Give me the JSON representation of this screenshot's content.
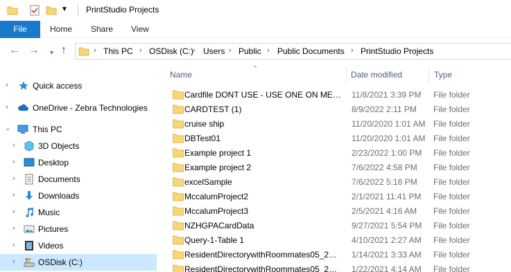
{
  "window": {
    "title": "PrintStudio Projects"
  },
  "quick_access_toolbar": [
    "folder-icon",
    "properties-icon",
    "new-folder-icon",
    "customize-dropdown"
  ],
  "ribbon": {
    "tabs": [
      "File",
      "Home",
      "Share",
      "View"
    ]
  },
  "address": {
    "crumbs": [
      "This PC",
      "OSDisk (C:)",
      "Users",
      "Public",
      "Public Documents",
      "PrintStudio Projects"
    ]
  },
  "nav": {
    "items": [
      {
        "label": "Quick access",
        "icon": "star-icon"
      },
      {
        "label": "OneDrive - Zebra Technologies",
        "icon": "cloud-icon"
      },
      {
        "label": "This PC",
        "icon": "computer-icon",
        "expanded": true
      },
      {
        "label": "3D Objects",
        "icon": "cube-icon"
      },
      {
        "label": "Desktop",
        "icon": "desktop-icon"
      },
      {
        "label": "Documents",
        "icon": "document-icon"
      },
      {
        "label": "Downloads",
        "icon": "download-icon"
      },
      {
        "label": "Music",
        "icon": "music-icon"
      },
      {
        "label": "Pictures",
        "icon": "picture-icon"
      },
      {
        "label": "Videos",
        "icon": "video-icon"
      },
      {
        "label": "OSDisk (C:)",
        "icon": "drive-icon",
        "selected": true
      }
    ]
  },
  "files": {
    "columns": {
      "name": "Name",
      "date": "Date modified",
      "type": "Type"
    },
    "rows": [
      {
        "name": "Cardfile DONT USE - USE ONE ON MEMB...",
        "date": "11/8/2021 3:39 PM",
        "type": "File folder"
      },
      {
        "name": "CARDTEST (1)",
        "date": "8/9/2022 2:11 PM",
        "type": "File folder"
      },
      {
        "name": "cruise ship",
        "date": "11/20/2020 1:01 AM",
        "type": "File folder"
      },
      {
        "name": "DBTest01",
        "date": "11/20/2020 1:01 AM",
        "type": "File folder"
      },
      {
        "name": "Example project 1",
        "date": "2/23/2022 1:00 PM",
        "type": "File folder"
      },
      {
        "name": "Example project 2",
        "date": "7/6/2022 4:58 PM",
        "type": "File folder"
      },
      {
        "name": "excelSample",
        "date": "7/6/2022 5:16 PM",
        "type": "File folder"
      },
      {
        "name": "MccalumProject2",
        "date": "2/1/2021 11:41 PM",
        "type": "File folder"
      },
      {
        "name": "MccalumProject3",
        "date": "2/5/2021 4:16 AM",
        "type": "File folder"
      },
      {
        "name": "NZHGPACardData",
        "date": "9/27/2021 5:54 PM",
        "type": "File folder"
      },
      {
        "name": "Query-1-Table 1",
        "date": "4/10/2021 2:27 AM",
        "type": "File folder"
      },
      {
        "name": "ResidentDirectorywithRoommates05_21_...",
        "date": "1/14/2021 3:33 AM",
        "type": "File folder"
      },
      {
        "name": "ResidentDirectorywithRoommates05_21_...",
        "date": "1/22/2021 4:14 AM",
        "type": "File folder"
      }
    ]
  },
  "colors": {
    "accent": "#1979ca",
    "selection": "#cce8ff",
    "folder": "#f8d775",
    "header_text": "#4c607a"
  }
}
